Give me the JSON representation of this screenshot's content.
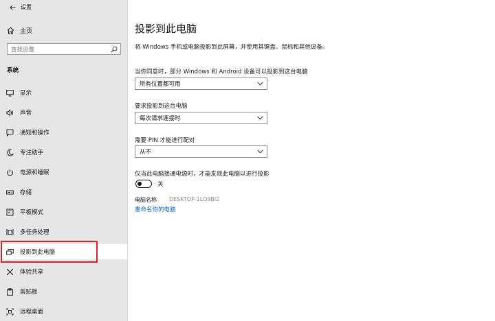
{
  "window": {
    "title": "设置"
  },
  "sidebar": {
    "home_label": "主页",
    "search_placeholder": "查找设置",
    "section_title": "系统",
    "items": [
      {
        "label": "显示",
        "icon": "monitor-icon"
      },
      {
        "label": "声音",
        "icon": "speaker-icon"
      },
      {
        "label": "通知和操作",
        "icon": "notification-icon"
      },
      {
        "label": "专注助手",
        "icon": "moon-icon"
      },
      {
        "label": "电源和睡眠",
        "icon": "power-icon"
      },
      {
        "label": "存储",
        "icon": "storage-icon"
      },
      {
        "label": "平板模式",
        "icon": "tablet-icon"
      },
      {
        "label": "多任务处理",
        "icon": "multitask-icon"
      },
      {
        "label": "投影到此电脑",
        "icon": "project-icon",
        "selected": true
      },
      {
        "label": "体验共享",
        "icon": "share-icon"
      },
      {
        "label": "剪贴板",
        "icon": "clipboard-icon"
      },
      {
        "label": "远程桌面",
        "icon": "remote-desktop-icon"
      }
    ]
  },
  "main": {
    "title": "投影到此电脑",
    "description": "将 Windows 手机或电脑投影到此屏幕，并使用其键盘、鼠标和其他设备。",
    "setting1": {
      "label": "当你同意时，部分 Windows 和 Android 设备可以投影到这台电脑",
      "value": "所有位置都可用"
    },
    "setting2": {
      "label": "要求投影到这台电脑",
      "value": "每次请求连接时"
    },
    "setting3": {
      "label": "需要 PIN 才能进行配对",
      "value": "从不"
    },
    "setting4": {
      "label": "仅当此电脑接通电源时，才能发现此电脑以进行投影",
      "toggle_state": "关"
    },
    "pc_name_label": "电脑名称",
    "pc_name_value": "DESKTOP-1LO9BI2",
    "rename_link": "重命名你的电脑"
  }
}
